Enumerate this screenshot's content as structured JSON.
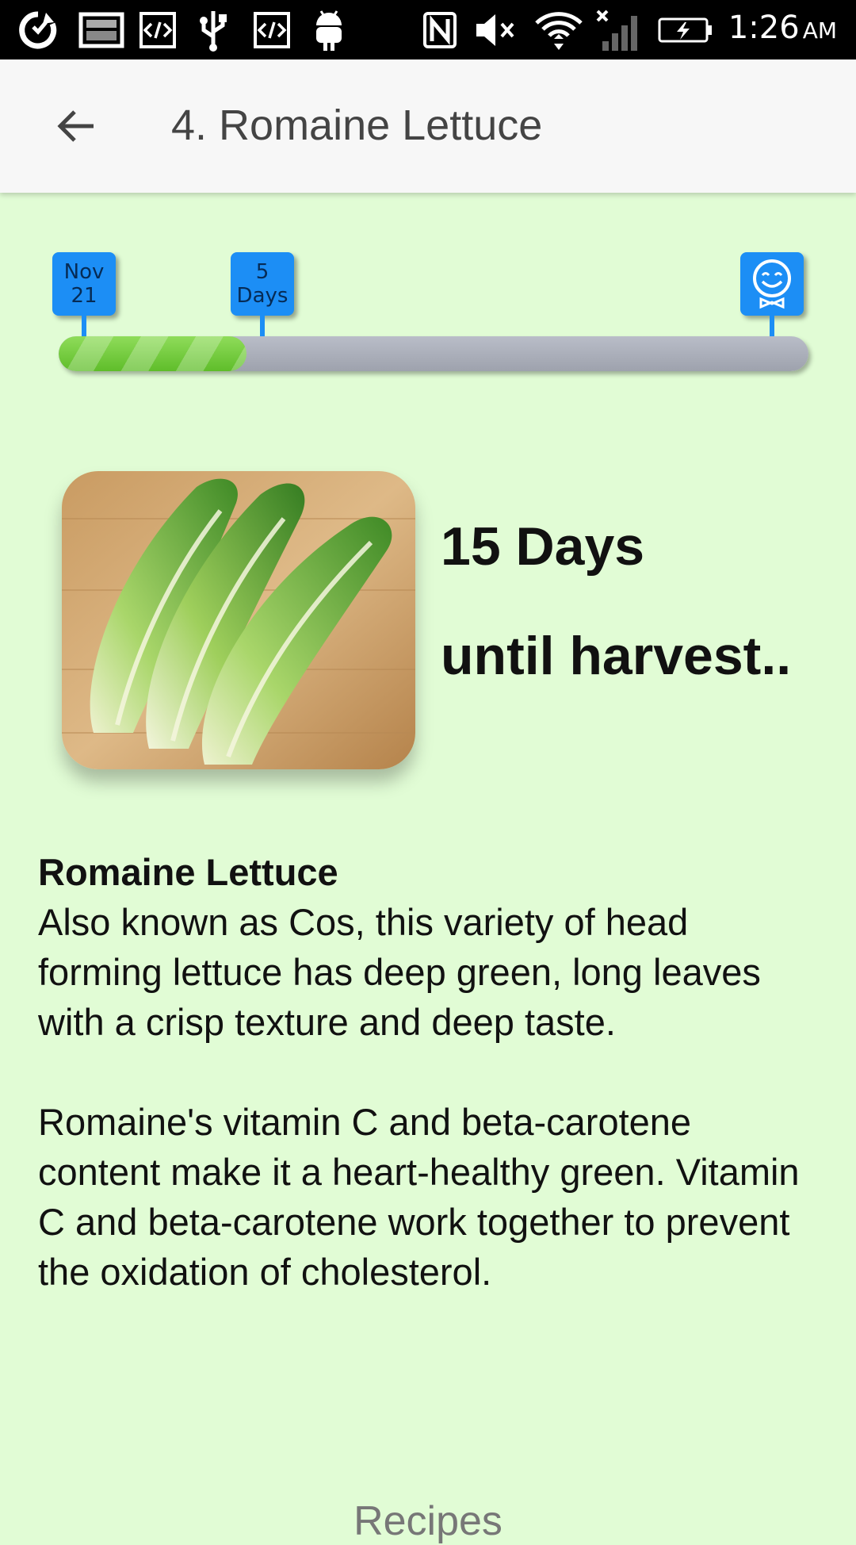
{
  "status_bar": {
    "time": "1:26",
    "ampm": "AM",
    "icons": [
      "sync-icon",
      "image-icon",
      "code-icon",
      "usb-icon",
      "code-icon",
      "android-icon",
      "nfc-icon",
      "mute-icon",
      "wifi-icon",
      "no-signal-icon",
      "battery-charging-icon"
    ]
  },
  "app_bar": {
    "back_icon": "arrow-left-icon",
    "title": "4. Romaine Lettuce"
  },
  "timeline": {
    "start_label_line1": "Nov",
    "start_label_line2": "21",
    "current_label_line1": "5",
    "current_label_line2": "Days",
    "end_icon": "smiley-icon",
    "progress_fraction": 0.25,
    "fill_color": "#6cc93a",
    "track_color": "#a9adb8",
    "marker_color": "#1c8ef5"
  },
  "harvest": {
    "days": "15 Days",
    "until": "until harvest.."
  },
  "plant": {
    "name": "Romaine Lettuce",
    "paragraph1": "Also known as Cos, this variety of head forming lettuce has deep green, long leaves with a crisp texture and deep taste.",
    "paragraph2": "Romaine's vitamin C and beta-carotene content make it a heart-healthy green. Vitamin C and beta-carotene work together to prevent the oxidation of cholesterol."
  },
  "footer": {
    "recipes_label": "Recipes"
  }
}
